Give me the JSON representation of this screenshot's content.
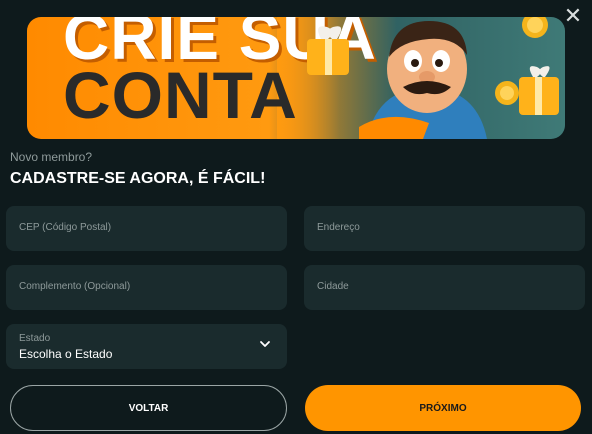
{
  "banner": {
    "line1": "CRIE SUA",
    "line2": "CONTA"
  },
  "intro": {
    "small": "Novo membro?",
    "headline": "CADASTRE-SE AGORA, É FÁCIL!"
  },
  "fields": {
    "cep": "CEP (Código Postal)",
    "endereco": "Endereço",
    "complemento": "Complemento (Opcional)",
    "cidade": "Cidade"
  },
  "estado": {
    "label": "Estado",
    "value": "Escolha o Estado"
  },
  "buttons": {
    "back": "VOLTAR",
    "next": "PRÓXIMO"
  },
  "icons": {
    "close": "close-icon",
    "chevron": "chevron-down-icon"
  },
  "colors": {
    "background": "#0e1a1c",
    "field": "#1a2b2d",
    "accent": "#ff9500"
  }
}
